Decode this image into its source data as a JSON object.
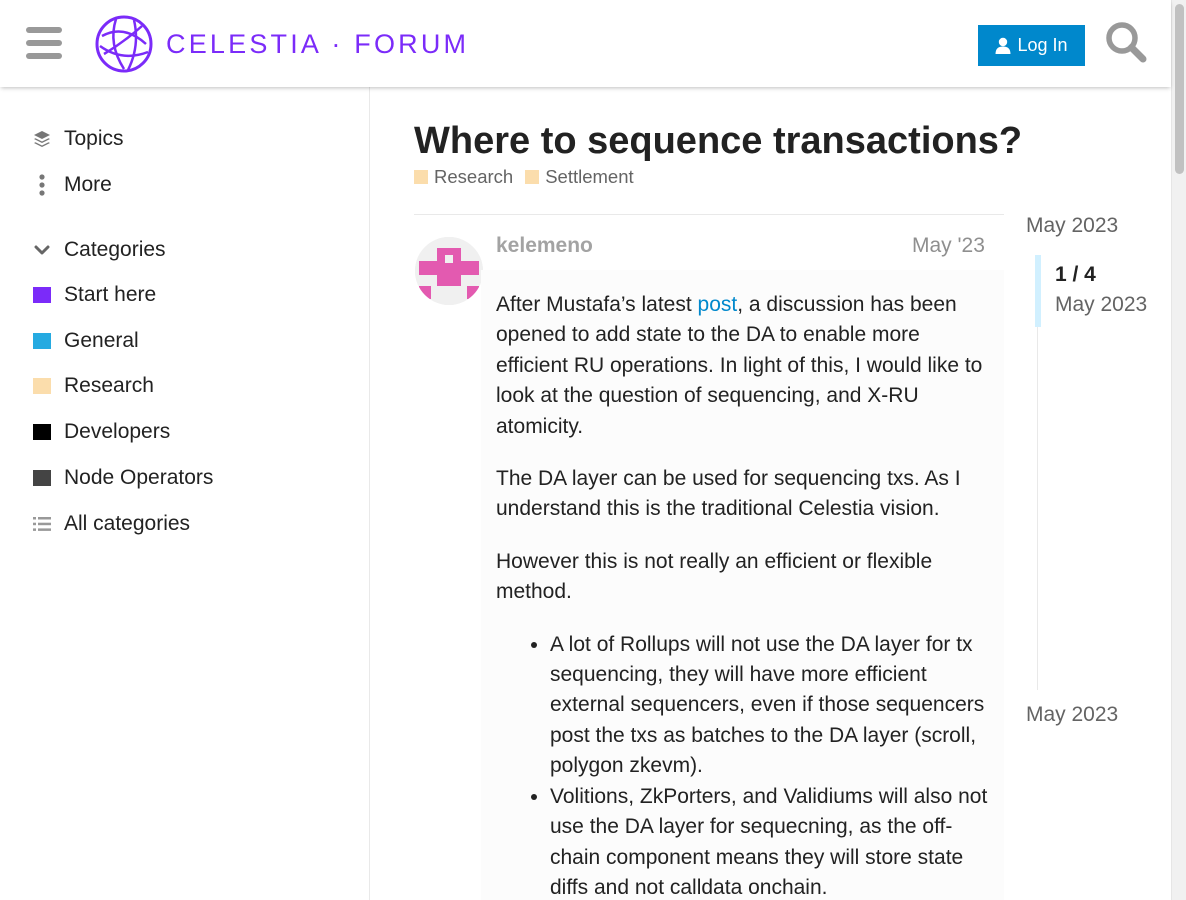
{
  "header": {
    "logo_text": "CELESTIA · FORUM",
    "login_label": "Log In",
    "accent_color": "#7B2BF9",
    "login_color": "#0088cc"
  },
  "sidebar": {
    "topics_label": "Topics",
    "more_label": "More",
    "categories_label": "Categories",
    "categories": [
      {
        "label": "Start here",
        "color": "#7B2BF9"
      },
      {
        "label": "General",
        "color": "#25AAE1"
      },
      {
        "label": "Research",
        "color": "#FBDDAC"
      },
      {
        "label": "Developers",
        "color": "#000000"
      },
      {
        "label": "Node Operators",
        "color": "#444444"
      }
    ],
    "all_categories_label": "All categories"
  },
  "topic": {
    "title": "Where to sequence transactions?",
    "tags": [
      {
        "label": "Research",
        "color": "#FBDDAC"
      },
      {
        "label": "Settlement",
        "color": "#FBDDAC"
      }
    ]
  },
  "post": {
    "username": "kelemeno",
    "date": "May '23",
    "p1_before": "After Mustafa’s latest ",
    "p1_link": "post",
    "p1_after": ", a discussion has been opened to add state to the DA to enable more efficient RU operations. In light of this, I would like to look at the question of sequencing, and X-RU atomicity.",
    "p2": "The DA layer can be used for sequencing txs. As I understand this is the traditional Celestia vision.",
    "p3": "However this is not really an efficient or flexible method.",
    "bullets": [
      "A lot of Rollups will not use the DA layer for tx sequencing, they will have more efficient external sequencers, even if those sequencers post the txs as batches to the DA layer (scroll, polygon zkevm).",
      "Volitions, ZkPorters, and Validiums will also not use the DA layer for sequecning, as the off-chain component means they will store state diffs and not calldata onchain."
    ]
  },
  "timeline": {
    "start_date": "May 2023",
    "position": "1 / 4",
    "current_date": "May 2023",
    "end_date": "May 2023"
  }
}
